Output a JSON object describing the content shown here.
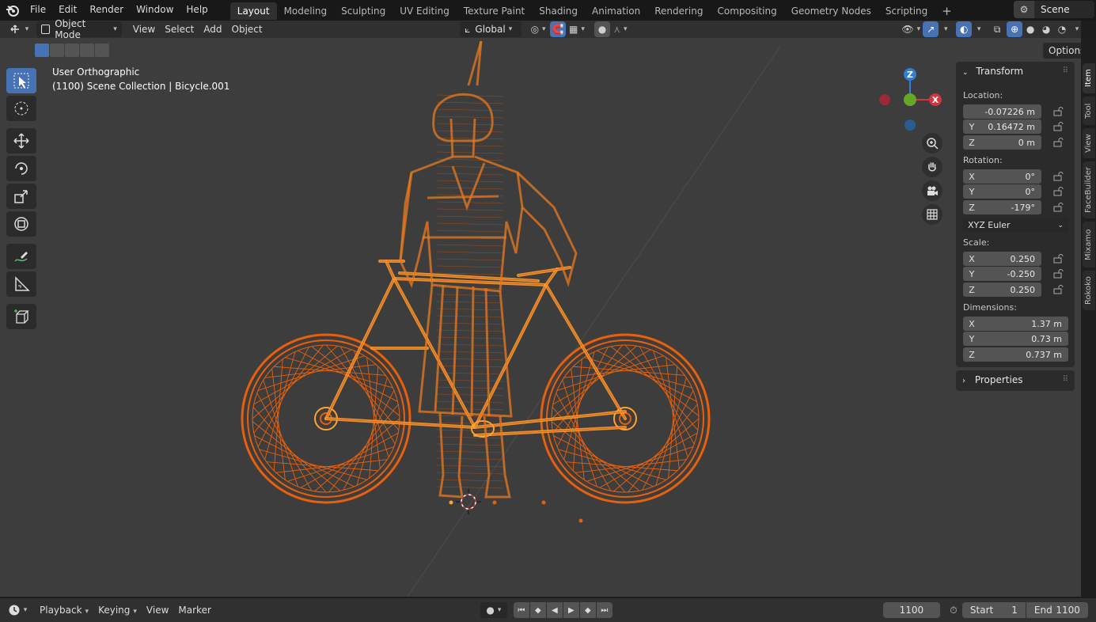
{
  "topbar": {
    "menus": [
      "File",
      "Edit",
      "Render",
      "Window",
      "Help"
    ],
    "workspaces": [
      "Layout",
      "Modeling",
      "Sculpting",
      "UV Editing",
      "Texture Paint",
      "Shading",
      "Animation",
      "Rendering",
      "Compositing",
      "Geometry Nodes",
      "Scripting"
    ],
    "active_workspace": "Layout",
    "add_tab": "+",
    "scene_name": "Scene"
  },
  "viewport_header": {
    "mode": "Object Mode",
    "menus": [
      "View",
      "Select",
      "Add",
      "Object"
    ],
    "transform_orientation": "Global",
    "options_label": "Options"
  },
  "viewport": {
    "view_name": "User Orthographic",
    "collection_info": "(1100) Scene Collection | Bicycle.001",
    "wire_color": "#e8600c",
    "highlight_color": "#ffa233",
    "gizmo": {
      "z": "Z",
      "x": "X"
    }
  },
  "npanel": {
    "transform_title": "Transform",
    "location_label": "Location:",
    "location": [
      {
        "axis": "",
        "value": "-0.07226 m"
      },
      {
        "axis": "Y",
        "value": "0.16472 m"
      },
      {
        "axis": "Z",
        "value": "0 m"
      }
    ],
    "rotation_label": "Rotation:",
    "rotation": [
      {
        "axis": "X",
        "value": "0°"
      },
      {
        "axis": "Y",
        "value": "0°"
      },
      {
        "axis": "Z",
        "value": "-179°"
      }
    ],
    "rotation_mode": "XYZ Euler",
    "scale_label": "Scale:",
    "scale": [
      {
        "axis": "X",
        "value": "0.250"
      },
      {
        "axis": "Y",
        "value": "-0.250"
      },
      {
        "axis": "Z",
        "value": "0.250"
      }
    ],
    "dimensions_label": "Dimensions:",
    "dimensions": [
      {
        "axis": "X",
        "value": "1.37 m"
      },
      {
        "axis": "Y",
        "value": "0.73 m"
      },
      {
        "axis": "Z",
        "value": "0.737 m"
      }
    ],
    "properties_title": "Properties"
  },
  "side_tabs": [
    "Item",
    "Tool",
    "View",
    "FaceBuilder",
    "Mixamo",
    "Rokoko"
  ],
  "timeline": {
    "menus": [
      "Playback",
      "Keying",
      "View",
      "Marker"
    ],
    "current_frame": "1100",
    "start_label": "Start",
    "start_value": "1",
    "end_label": "End",
    "end_value": "1100"
  }
}
